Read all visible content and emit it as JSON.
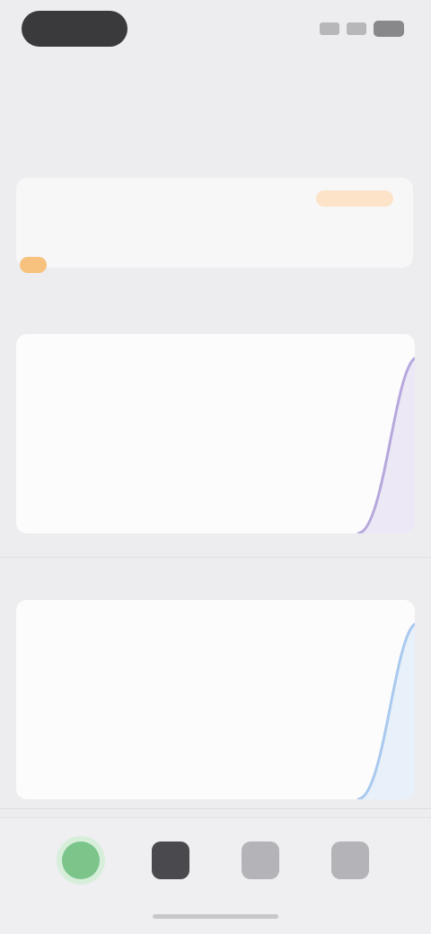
{
  "status_bar": {
    "time": "",
    "icons": [
      "signal-icon",
      "wifi-icon",
      "battery-icon"
    ]
  },
  "nav": {
    "title": ""
  },
  "section": {
    "title": ""
  },
  "notice": {
    "subtitle": "",
    "badge": "",
    "text": ""
  },
  "charts": [
    {
      "label": "",
      "line_color": "#b7a8dc",
      "fill_color": "#ede8f6",
      "axis_labels": [],
      "caption": ""
    },
    {
      "label": "",
      "line_color": "#a9c9ee",
      "fill_color": "#e8f0fa",
      "axis_labels": [],
      "caption": ""
    }
  ],
  "tab_bar": {
    "items": [
      {
        "icon": "home-icon",
        "label": "",
        "color": "#7bc48a",
        "active": true
      },
      {
        "icon": "profile-icon",
        "label": "",
        "color": "#4a4a4e",
        "active": false
      },
      {
        "icon": "stats-icon",
        "label": "",
        "color": "#b4b4b8",
        "active": false
      },
      {
        "icon": "settings-icon",
        "label": "",
        "color": "#b4b4b8",
        "active": false
      }
    ]
  },
  "colors": {
    "background": "#ededef",
    "card": "#fcfcfd",
    "accent_orange": "#f08a24",
    "accent_green": "#7bc48a"
  }
}
